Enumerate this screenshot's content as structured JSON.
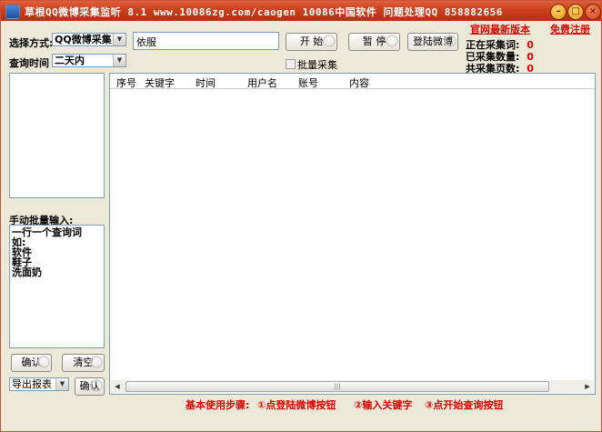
{
  "window": {
    "title": "草根QQ微博采集监听 8.1   www.10086zg.com/caogen  10086中国软件   问题处理QQ 858882656",
    "minimize_glyph": "–",
    "maximize_glyph": "□",
    "close_glyph": "×"
  },
  "links": {
    "official_update": "官网最新版本",
    "free_register": "免费注册"
  },
  "controls": {
    "select_mode_label": "选择方式:",
    "select_mode_value": "QQ微博采集",
    "keyword_value": "依服",
    "start_button": "开 始",
    "pause_button": "暂 停",
    "login_button": "登陆微博",
    "query_time_label": "查询时间",
    "query_time_value": "二天内",
    "batch_collect_label": "批量采集"
  },
  "status": {
    "current_keyword_label": "正在采集词:",
    "current_keyword_value": "0",
    "collected_count_label": "已采集数量:",
    "collected_count_value": "0",
    "pages_label": "共采集页数:",
    "pages_value": "0"
  },
  "table": {
    "columns": [
      "序号",
      "关键字",
      "时间",
      "用户名",
      "账号",
      "内容"
    ]
  },
  "manual": {
    "label": "手动批量输入:",
    "text": "一行一个查询词\n如:\n软件\n鞋子\n洗面奶",
    "confirm_button": "确认",
    "clear_button": "清空",
    "export_select": "导出报表",
    "export_confirm_button": "确认"
  },
  "steps": {
    "title": "基本使用步骤:",
    "step1": "①点登陆微博按钮",
    "step2": "②输入关键字",
    "step3": "③点开始查询按钮"
  },
  "scroll_thumb_glyph": "|||",
  "colors": {
    "title_bar": "#cc3f1c",
    "accent_red": "#e00000",
    "window_bg": "#ece9d8"
  }
}
